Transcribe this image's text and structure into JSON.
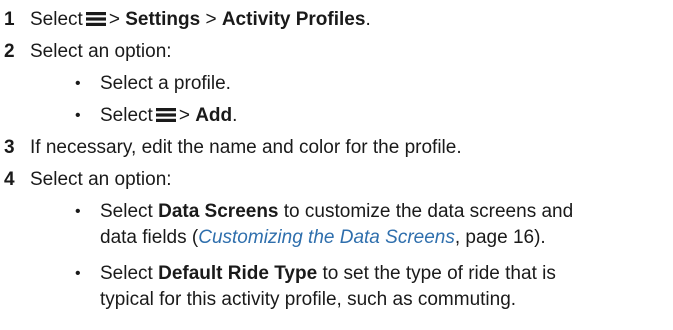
{
  "top_fragment": "...",
  "steps": {
    "s1": {
      "number": "1",
      "select": "Select",
      "menu_icon": "menu-icon",
      "sep1": ">",
      "settings": "Settings",
      "sep2": ">",
      "activity_profiles": "Activity Profiles",
      "period": "."
    },
    "s2": {
      "number": "2",
      "text": "Select an option:",
      "bullets": {
        "b1": {
          "text": "Select a profile."
        },
        "b2": {
          "select": "Select",
          "menu_icon": "menu-icon",
          "sep": ">",
          "add": "Add",
          "period": "."
        }
      }
    },
    "s3": {
      "number": "3",
      "text": "If necessary, edit the name and color for the profile."
    },
    "s4": {
      "number": "4",
      "text": "Select an option:",
      "bullets": {
        "b1": {
          "select": "Select",
          "bold": "Data Screens",
          "rest1": "to customize the data screens and",
          "line2_a": "data fields (",
          "link": "Customizing the Data Screens",
          "line2_b": ", page 16)."
        },
        "b2": {
          "select": "Select",
          "bold": "Default Ride Type",
          "rest1": "to set the type of ride that is",
          "line2": "typical for this activity profile, such as commuting."
        }
      }
    }
  },
  "bullet_glyph": "•"
}
